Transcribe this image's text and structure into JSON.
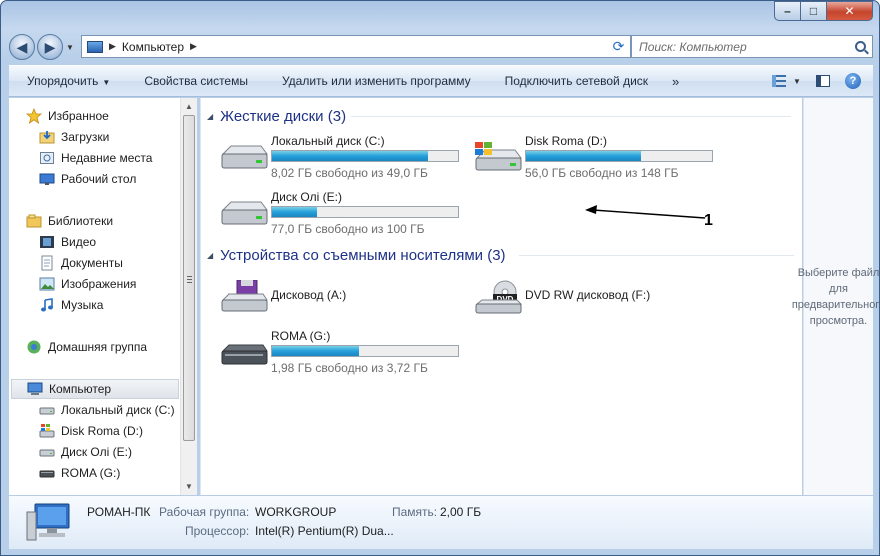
{
  "address": {
    "crumb": "Компьютер"
  },
  "search": {
    "placeholder": "Поиск: Компьютер"
  },
  "commands": [
    {
      "label": "Упорядочить",
      "dropdown": true
    },
    {
      "label": "Свойства системы"
    },
    {
      "label": "Удалить или изменить программу"
    },
    {
      "label": "Подключить сетевой диск"
    },
    {
      "label": "»"
    }
  ],
  "nav": {
    "favorites": {
      "label": "Избранное",
      "items": [
        "Загрузки",
        "Недавние места",
        "Рабочий стол"
      ]
    },
    "libraries": {
      "label": "Библиотеки",
      "items": [
        "Видео",
        "Документы",
        "Изображения",
        "Музыка"
      ]
    },
    "homegroup": {
      "label": "Домашняя группа"
    },
    "computer": {
      "label": "Компьютер",
      "items": [
        "Локальный диск (C:)",
        "Disk Roma (D:)",
        "Диск Олі (E:)",
        "ROMA (G:)"
      ]
    }
  },
  "groups": {
    "hdd": {
      "header": "Жесткие диски (3)",
      "drives": [
        {
          "name": "Локальный диск (C:)",
          "free": "8,02 ГБ свободно из 49,0 ГБ",
          "used_fraction": 0.84,
          "icon": "hdd-icon"
        },
        {
          "name": "Disk Roma (D:)",
          "free": "56,0 ГБ свободно из 148 ГБ",
          "used_fraction": 0.62,
          "icon": "windows-hdd-icon"
        },
        {
          "name": "Диск Олі (E:)",
          "free": "77,0 ГБ свободно из 100 ГБ",
          "used_fraction": 0.24,
          "icon": "hdd-icon"
        }
      ]
    },
    "removable": {
      "header": "Устройства со съемными носителями (3)",
      "drives": [
        {
          "name": "Дисковод (A:)",
          "icon": "floppy-drive-icon"
        },
        {
          "name": "DVD RW дисковод (F:)",
          "icon": "dvd-drive-icon",
          "badge": "DVD"
        },
        {
          "name": "ROMA (G:)",
          "free": "1,98 ГБ свободно из 3,72 ГБ",
          "used_fraction": 0.47,
          "icon": "usb-drive-icon"
        }
      ]
    }
  },
  "annotation": {
    "label": "1"
  },
  "preview": {
    "text": "Выберите файл для предварительного просмотра."
  },
  "details": {
    "pc_name": "РОМАН-ПК",
    "workgroup_label": "Рабочая группа:",
    "workgroup_value": "WORKGROUP",
    "memory_label": "Память:",
    "memory_value": "2,00 ГБ",
    "cpu_label": "Процессор:",
    "cpu_value": "Intel(R) Pentium(R) Dua..."
  },
  "colors": {
    "bar_fill": "#26a0da",
    "group_header": "#1e3287",
    "frame": "#b8cfe9"
  }
}
